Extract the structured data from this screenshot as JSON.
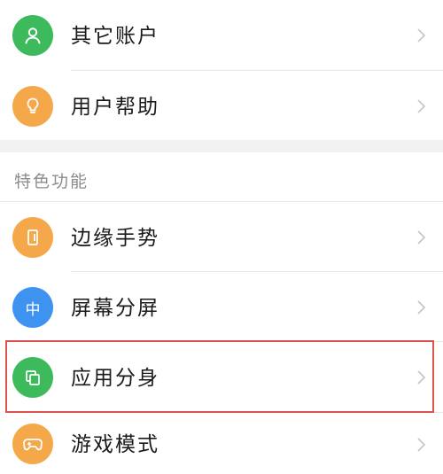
{
  "colors": {
    "green": "#3cba5c",
    "orange": "#f5a84a",
    "blue": "#3f93f0",
    "highlight": "#d9534f"
  },
  "rows": [
    {
      "label": "其它账户",
      "icon": "user-icon",
      "color": "green"
    },
    {
      "label": "用户帮助",
      "icon": "lightbulb-icon",
      "color": "orange"
    },
    {
      "label": "边缘手势",
      "icon": "edge-gesture-icon",
      "color": "orange"
    },
    {
      "label": "屏幕分屏",
      "icon": "split-screen-icon",
      "color": "blue",
      "icon_text": "中"
    },
    {
      "label": "应用分身",
      "icon": "app-clone-icon",
      "color": "green"
    },
    {
      "label": "游戏模式",
      "icon": "gamepad-icon",
      "color": "orange"
    }
  ],
  "section": {
    "title": "特色功能"
  }
}
